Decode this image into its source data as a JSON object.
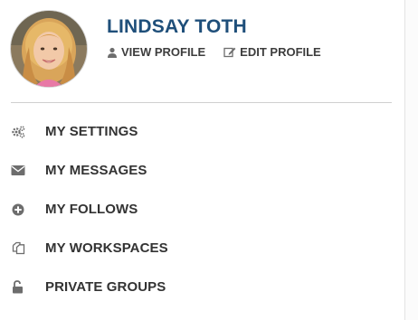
{
  "profile": {
    "name": "LINDSAY TOTH",
    "view_profile_label": "VIEW PROFILE",
    "edit_profile_label": "EDIT PROFILE",
    "avatar_icon": "user-avatar-photo",
    "name_color": "#1f4f7a"
  },
  "menu": {
    "items": [
      {
        "label": "MY SETTINGS",
        "icon": "gears-icon"
      },
      {
        "label": "MY MESSAGES",
        "icon": "envelope-icon"
      },
      {
        "label": "MY FOLLOWS",
        "icon": "plus-circle-icon"
      },
      {
        "label": "MY WORKSPACES",
        "icon": "copy-icon"
      },
      {
        "label": "PRIVATE GROUPS",
        "icon": "unlock-icon"
      }
    ]
  },
  "colors": {
    "text_dark": "#333333",
    "icon_gray": "#6d6d6d",
    "divider": "#cfcfcf"
  }
}
